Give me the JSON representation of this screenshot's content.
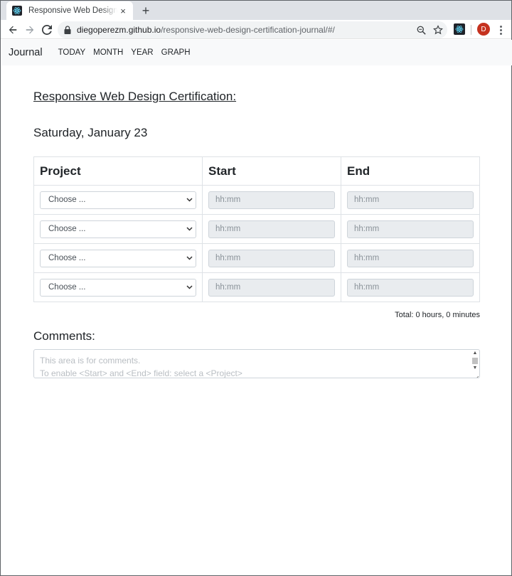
{
  "browser": {
    "tab_title": "Responsive Web Design Pr",
    "tab_close": "×",
    "new_tab": "+",
    "url_host": "diegoperezm.github.io",
    "url_path": "/responsive-web-design-certification-journal/#/",
    "avatar_letter": "D",
    "icons": [
      "back-icon",
      "forward-icon",
      "reload-icon",
      "lock-icon",
      "zoom-icon",
      "star-icon",
      "react-extension-icon",
      "menu-icon"
    ]
  },
  "navbar": {
    "brand": "Journal",
    "links": [
      "TODAY",
      "MONTH",
      "YEAR",
      "GRAPH"
    ]
  },
  "main": {
    "title": "Responsive Web Design Certification:",
    "date": "Saturday, January 23",
    "table": {
      "headers": [
        "Project",
        "Start",
        "End"
      ],
      "rows": [
        {
          "project": "Choose ...",
          "start": "hh:mm",
          "end": "hh:mm"
        },
        {
          "project": "Choose ...",
          "start": "hh:mm",
          "end": "hh:mm"
        },
        {
          "project": "Choose ...",
          "start": "hh:mm",
          "end": "hh:mm"
        },
        {
          "project": "Choose ...",
          "start": "hh:mm",
          "end": "hh:mm"
        }
      ]
    },
    "total": "Total: 0 hours, 0 minutes",
    "comments_label": "Comments:",
    "comments_placeholder": [
      "This area is for comments.",
      "To enable <Start> and <End> field: select a <Project>"
    ]
  },
  "colors": {
    "navbar_bg": "#f8f9fa",
    "input_disabled_bg": "#e9ecef",
    "tabstrip_bg": "#dee1e6",
    "avatar_bg": "#c5321f"
  }
}
